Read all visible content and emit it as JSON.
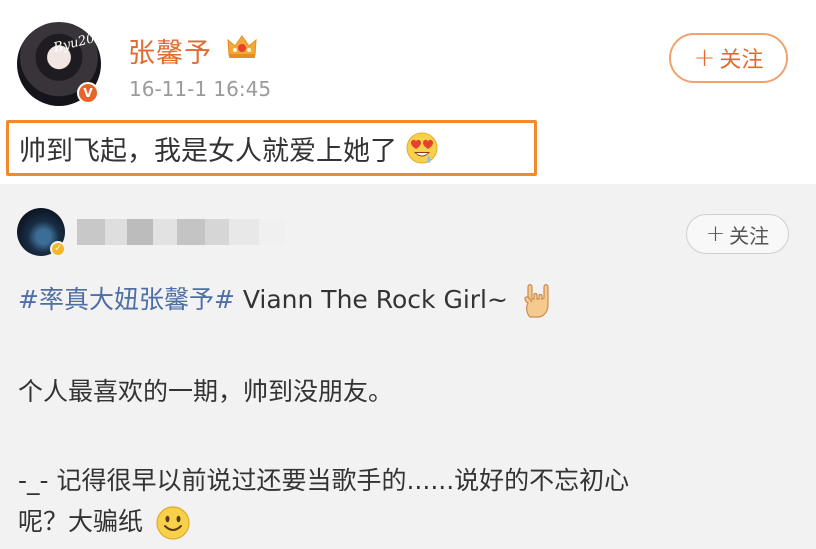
{
  "post": {
    "avatar_signature": "Byu2020",
    "username": "张馨予",
    "timestamp": "16-11-1 16:45",
    "follow_label": "关注",
    "follow_plus": "+",
    "text": "帅到飞起，我是女人就爱上她了",
    "verified_mark": "V"
  },
  "repost": {
    "follow_label": "关注",
    "follow_plus": "+",
    "hashtag": "#率真大妞张馨予#",
    "title_text": " Viann The Rock Girl~",
    "line2": "个人最喜欢的一期，帅到没朋友。",
    "line3": "-_- 记得很早以前说过还要当歌手的......说好的不忘初心",
    "line4": "呢？大骗纸"
  },
  "colors": {
    "accent": "#e36a2d",
    "highlight_border": "#f28a2b",
    "hashtag": "#4e6fa6",
    "repost_bg": "#f2f2f2"
  },
  "icons": [
    "crown-icon",
    "heart-eyes-emoji-icon",
    "rock-hand-emoji-icon",
    "smile-emoji-icon",
    "verified-badge-icon"
  ]
}
